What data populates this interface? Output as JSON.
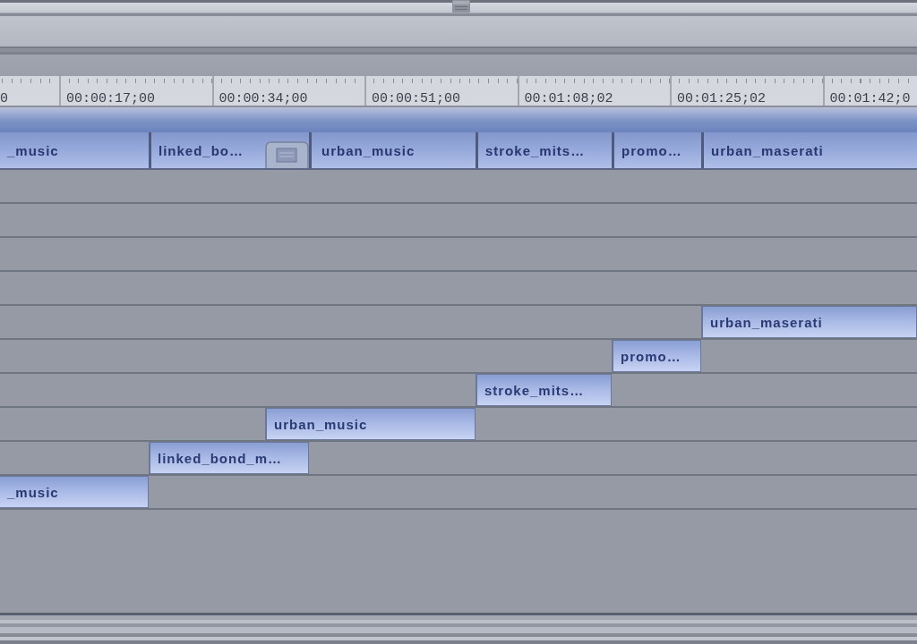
{
  "ruler": {
    "timecodes": [
      "0",
      "00:00:17;00",
      "00:00:34;00",
      "00:00:51;00",
      "00:01:08;02",
      "00:01:25;02",
      "00:01:42;0"
    ]
  },
  "sequence_track": {
    "clips": [
      {
        "name": "_music",
        "transition": false
      },
      {
        "name": "linked_bo…",
        "transition": true
      },
      {
        "name": "urban_music",
        "transition": false
      },
      {
        "name": "stroke_mits…",
        "transition": false
      },
      {
        "name": "promo…",
        "transition": false
      },
      {
        "name": "urban_maserati",
        "transition": false
      }
    ]
  },
  "tracks": [
    {
      "clip": "urban_maserati"
    },
    {
      "clip": "promo…"
    },
    {
      "clip": "stroke_mits…"
    },
    {
      "clip": "urban_music"
    },
    {
      "clip": "linked_bond_m…"
    },
    {
      "clip": "_music"
    }
  ]
}
